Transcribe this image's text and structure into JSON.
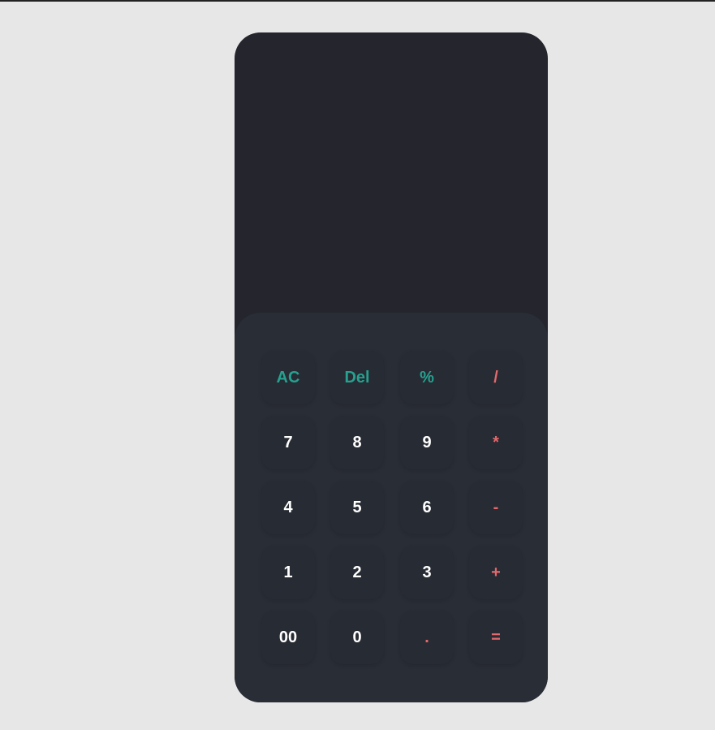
{
  "display": {
    "previous": "",
    "current": ""
  },
  "keys": {
    "ac": "AC",
    "del": "Del",
    "percent": "%",
    "divide": "/",
    "seven": "7",
    "eight": "8",
    "nine": "9",
    "multiply": "*",
    "four": "4",
    "five": "5",
    "six": "6",
    "subtract": "-",
    "one": "1",
    "two": "2",
    "three": "3",
    "add": "+",
    "double_zero": "00",
    "zero": "0",
    "decimal": ".",
    "equals": "="
  },
  "colors": {
    "page_background": "#e7e7e7",
    "display_background": "#24252d",
    "keypad_background": "#292d36",
    "key_background": "#272b33",
    "number_text": "#ffffff",
    "function_text": "#26a18f",
    "operator_text": "#e3696d"
  }
}
